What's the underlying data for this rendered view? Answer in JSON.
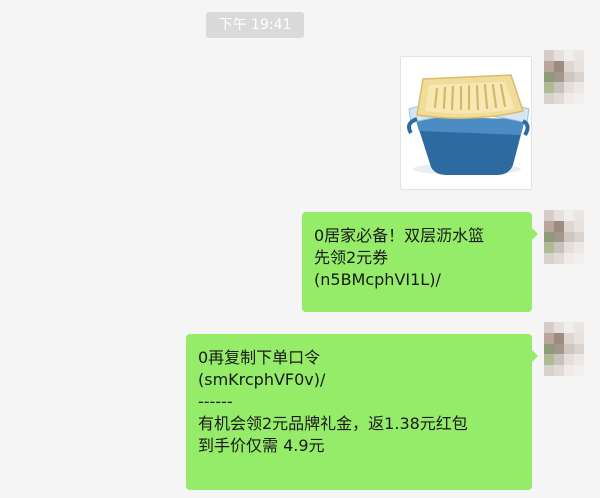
{
  "chat": {
    "timestamp": "下午 19:41",
    "messages": [
      {
        "type": "image",
        "image_icon": "colander-basket-image"
      },
      {
        "type": "text",
        "lines": [
          "0居家必备！双层沥水篮",
          "先领2元券",
          "(n5BMcphVI1L)/"
        ]
      },
      {
        "type": "text",
        "lines": [
          "0再复制下单口令",
          "(smKrcphVF0v)/",
          "------",
          "有机会领2元品牌礼金，返1.38元红包",
          "到手价仅需 4.9元"
        ]
      }
    ]
  },
  "colors": {
    "bubble": "#95ec69",
    "background": "#f5f5f5",
    "timestamp_bg": "#dadada",
    "text": "#191919"
  }
}
